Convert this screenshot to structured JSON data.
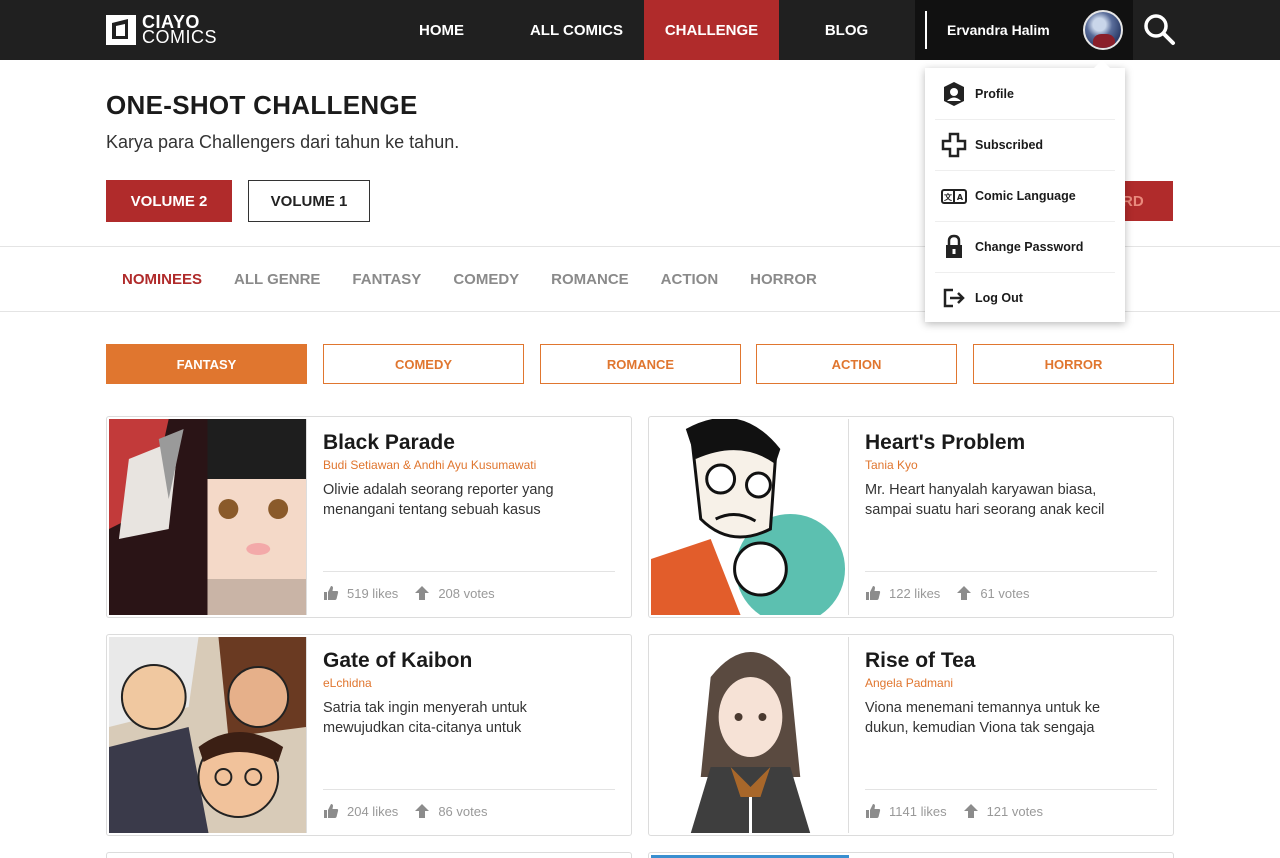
{
  "brand": {
    "name_line1": "CIAYO",
    "name_line2": "COMICS"
  },
  "nav": {
    "items": [
      {
        "label": "HOME"
      },
      {
        "label": "ALL COMICS"
      },
      {
        "label": "CHALLENGE"
      },
      {
        "label": "BLOG"
      }
    ],
    "active": "CHALLENGE"
  },
  "user": {
    "name": "Ervandra Halim"
  },
  "hero": {
    "title": "ONE-SHOT CHALLENGE",
    "subtitle": "Karya para Challengers dari tahun ke tahun.",
    "volume2_label": "VOLUME 2",
    "volume1_label": "VOLUME 1",
    "board_label_fragment": "RD"
  },
  "genre_tabs": {
    "items": [
      "NOMINEES",
      "ALL GENRE",
      "FANTASY",
      "COMEDY",
      "ROMANCE",
      "ACTION",
      "HORROR"
    ],
    "active": "NOMINEES"
  },
  "filters": {
    "items": [
      "FANTASY",
      "COMEDY",
      "ROMANCE",
      "ACTION",
      "HORROR"
    ],
    "active": "FANTASY"
  },
  "comics": [
    {
      "title": "Black Parade",
      "author": "Budi Setiawan & Andhi Ayu Kusumawati",
      "desc_line1": "Olivie adalah seorang reporter yang",
      "desc_line2": "menangani tentang sebuah kasus",
      "likes": "519 likes",
      "votes": "208 votes"
    },
    {
      "title": "Heart's Problem",
      "author": "Tania Kyo",
      "desc_line1": "Mr. Heart hanyalah karyawan biasa,",
      "desc_line2": "sampai suatu hari seorang anak kecil",
      "likes": "122 likes",
      "votes": "61 votes"
    },
    {
      "title": "Gate of Kaibon",
      "author": "eLchidna",
      "desc_line1": "Satria tak ingin menyerah untuk",
      "desc_line2": "mewujudkan cita-citanya untuk",
      "likes": "204 likes",
      "votes": "86 votes"
    },
    {
      "title": "Rise of Tea",
      "author": "Angela Padmani",
      "desc_line1": "Viona menemani temannya untuk ke",
      "desc_line2": "dukun, kemudian Viona tak sengaja",
      "likes": "1141 likes",
      "votes": "121 votes"
    }
  ],
  "user_menu": {
    "items": [
      {
        "label": "Profile",
        "icon": "profile-icon"
      },
      {
        "label": "Subscribed",
        "icon": "plus-icon"
      },
      {
        "label": "Comic Language",
        "icon": "language-icon"
      },
      {
        "label": "Change Password",
        "icon": "lock-icon"
      },
      {
        "label": "Log Out",
        "icon": "logout-icon"
      }
    ]
  },
  "colors": {
    "header_bg": "#202020",
    "accent_red": "#b02b2b",
    "accent_orange": "#e0762f"
  }
}
